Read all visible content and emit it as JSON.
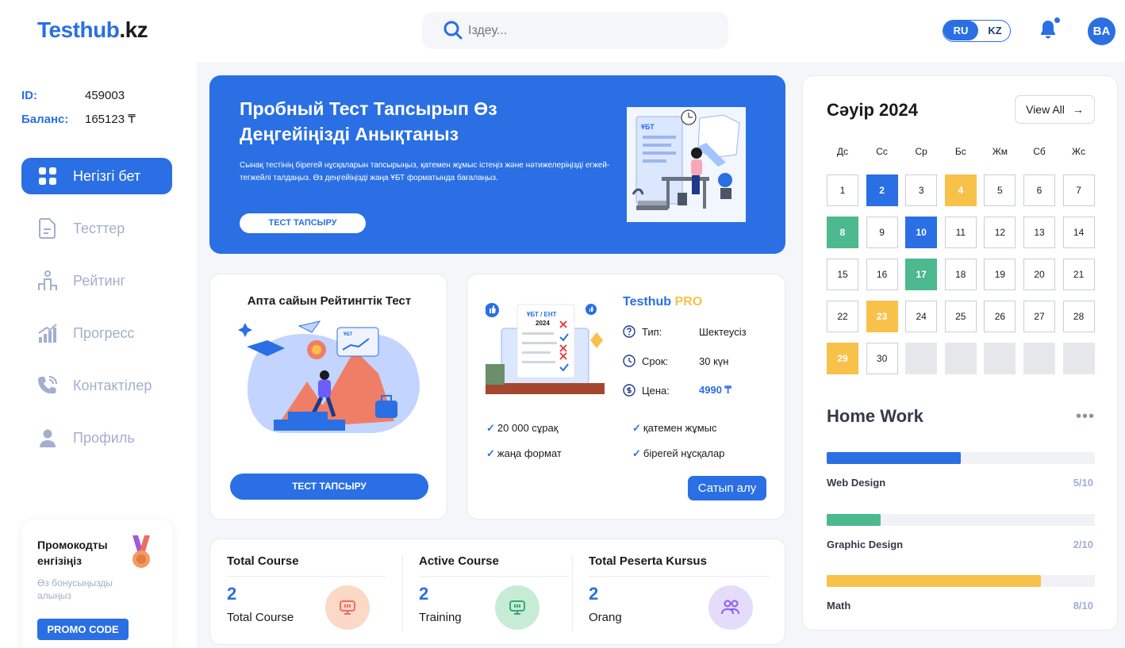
{
  "header": {
    "logo_main": "Testhub",
    "logo_tld": ".kz",
    "search_placeholder": "Іздеу...",
    "lang_ru": "RU",
    "lang_kz": "KZ",
    "avatar_initials": "BA"
  },
  "sidebar": {
    "id_label": "ID:",
    "id_value": "459003",
    "balance_label": "Баланс:",
    "balance_value": "165123 ₸",
    "nav": [
      {
        "label": "Негізгі бет",
        "icon": "grid-icon",
        "active": true
      },
      {
        "label": "Тесттер",
        "icon": "document-icon"
      },
      {
        "label": "Рейтинг",
        "icon": "podium-icon"
      },
      {
        "label": "Прогресс",
        "icon": "bar-chart-icon"
      },
      {
        "label": "Контактілер",
        "icon": "phone-icon"
      },
      {
        "label": "Профиль",
        "icon": "user-icon"
      }
    ],
    "promo": {
      "title": "Промокодты енгізіңіз",
      "subtitle": "Өз бонусыңызды алыңыз",
      "button": "PROMO CODE"
    }
  },
  "hero": {
    "title": "Пробный Тест Тапсырып Өз Деңгейіңізді Анықтаныз",
    "text": "Сынақ тестінің бірегей нұсқаларын тапсырыңыз, қатемен жұмыс істеңіз және нәтижелеріңізді егжей-тегжейлі талдаңыз. Өз деңгейіңізді жаңа ҰБТ форматында бағалаңыз.",
    "button": "ТЕСТ ТАПСЫРУ",
    "illustration_tag": "ҰБТ"
  },
  "weekly": {
    "title": "Апта сайын Рейтингтік Тест",
    "button": "ТЕСТ ТАПСЫРУ",
    "illustration_tag": "ҰБТ"
  },
  "pro": {
    "title_a": "Testhub",
    "title_b": "PRO",
    "doc_line1": "ҰБТ / ЕНТ",
    "doc_line2": "2024",
    "type_label": "Тип:",
    "type_value": "Шектеусіз",
    "term_label": "Срок:",
    "term_value": "30 күн",
    "price_label": "Цена:",
    "price_value": "4990 ₸",
    "features": [
      "20 000 сұрақ",
      "қатемен жұмыс",
      "жаңа формат",
      "бірегей нұсқалар"
    ],
    "buy_button": "Сатып алу"
  },
  "stats": [
    {
      "title": "Total Course",
      "value": "2",
      "label": "Total Course",
      "color": "#fcd8c6",
      "icon": "monitor-icon"
    },
    {
      "title": "Active Course",
      "value": "2",
      "label": "Training",
      "color": "#c6ecd6",
      "icon": "monitor-icon"
    },
    {
      "title": "Total Peserta Kursus",
      "value": "2",
      "label": "Orang",
      "color": "#e5dcfb",
      "icon": "users-icon"
    }
  ],
  "calendar": {
    "title": "Сәуір 2024",
    "view_all": "View All",
    "weekdays": [
      "Дс",
      "Сс",
      "Ср",
      "Бс",
      "Жм",
      "Сб",
      "Жс"
    ],
    "days": [
      {
        "d": "1"
      },
      {
        "d": "2",
        "s": "blue"
      },
      {
        "d": "3"
      },
      {
        "d": "4",
        "s": "yellow"
      },
      {
        "d": "5"
      },
      {
        "d": "6"
      },
      {
        "d": "7"
      },
      {
        "d": "8",
        "s": "green"
      },
      {
        "d": "9"
      },
      {
        "d": "10",
        "s": "blue"
      },
      {
        "d": "11"
      },
      {
        "d": "12"
      },
      {
        "d": "13"
      },
      {
        "d": "14"
      },
      {
        "d": "15"
      },
      {
        "d": "16"
      },
      {
        "d": "17",
        "s": "green"
      },
      {
        "d": "18"
      },
      {
        "d": "19"
      },
      {
        "d": "20"
      },
      {
        "d": "21"
      },
      {
        "d": "22"
      },
      {
        "d": "23",
        "s": "yellow"
      },
      {
        "d": "24"
      },
      {
        "d": "25"
      },
      {
        "d": "26"
      },
      {
        "d": "27"
      },
      {
        "d": "28"
      },
      {
        "d": "29",
        "s": "yellow"
      },
      {
        "d": "30"
      },
      {
        "d": "",
        "s": "empty"
      },
      {
        "d": "",
        "s": "empty"
      },
      {
        "d": "",
        "s": "empty"
      },
      {
        "d": "",
        "s": "empty"
      },
      {
        "d": "",
        "s": "empty"
      }
    ]
  },
  "homework": {
    "title": "Home Work",
    "items": [
      {
        "name": "Web Design",
        "value": "5/10",
        "progress": 0.5,
        "color": "#2a6fe3"
      },
      {
        "name": "Graphic Design",
        "value": "2/10",
        "progress": 0.2,
        "color": "#4cb98e"
      },
      {
        "name": "Math",
        "value": "8/10",
        "progress": 0.8,
        "color": "#f8c14a"
      }
    ]
  }
}
